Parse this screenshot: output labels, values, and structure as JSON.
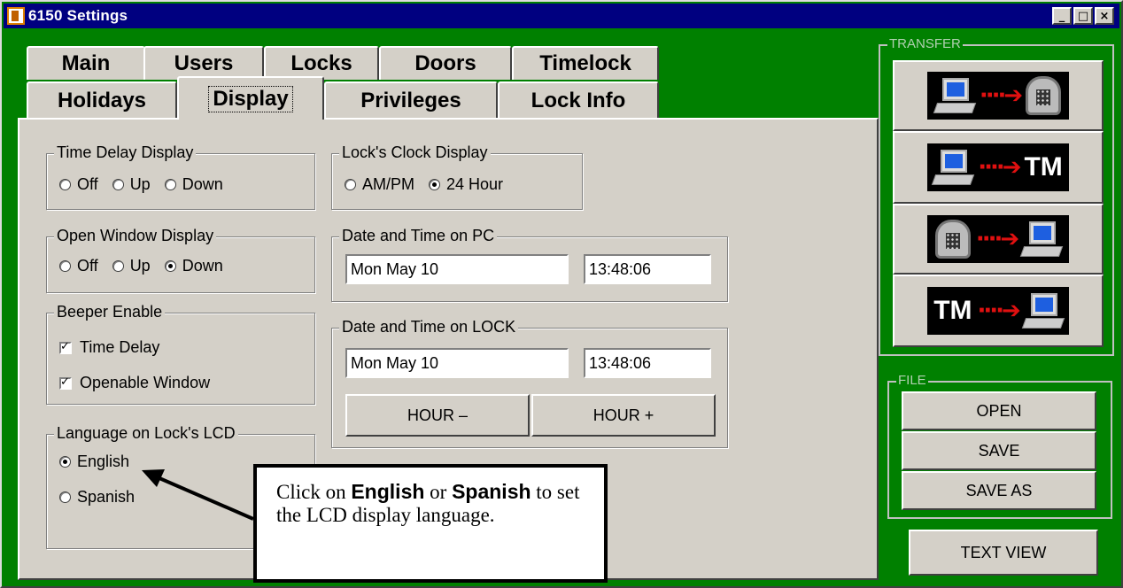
{
  "window": {
    "title": "6150 Settings",
    "controls": {
      "minimize": "_",
      "maximize": "□",
      "close": "×"
    }
  },
  "tabs": {
    "row1": [
      "Main",
      "Users",
      "Locks",
      "Doors",
      "Timelock"
    ],
    "row2": [
      "Holidays",
      "Display",
      "Privileges",
      "Lock Info"
    ],
    "active": "Display"
  },
  "time_delay_display": {
    "legend": "Time Delay Display",
    "options": [
      "Off",
      "Up",
      "Down"
    ],
    "selected": null
  },
  "open_window_display": {
    "legend": "Open Window Display",
    "options": [
      "Off",
      "Up",
      "Down"
    ],
    "selected": "Down"
  },
  "beeper_enable": {
    "legend": "Beeper Enable",
    "time_delay": {
      "label": "Time Delay",
      "checked": true
    },
    "openable_window": {
      "label": "Openable Window",
      "checked": true
    }
  },
  "language": {
    "legend": "Language on Lock's LCD",
    "options": [
      "English",
      "Spanish"
    ],
    "selected": "English"
  },
  "lock_clock_display": {
    "legend": "Lock's Clock Display",
    "options": [
      "AM/PM",
      "24 Hour"
    ],
    "selected": "24 Hour"
  },
  "pc_datetime": {
    "legend": "Date and Time on PC",
    "date": "Mon May 10",
    "time": "13:48:06"
  },
  "lock_datetime": {
    "legend": "Date and Time on LOCK",
    "date": "Mon May 10",
    "time": "13:48:06",
    "hour_minus": "HOUR –",
    "hour_plus": "HOUR +"
  },
  "transfer": {
    "legend": "TRANSFER",
    "buttons": [
      {
        "icon": "pc-to-lock-icon"
      },
      {
        "icon": "pc-to-tm-icon",
        "text": "TM"
      },
      {
        "icon": "lock-to-pc-icon"
      },
      {
        "icon": "tm-to-pc-icon",
        "text": "TM"
      }
    ]
  },
  "file": {
    "legend": "FILE",
    "open": "OPEN",
    "save": "SAVE",
    "save_as": "SAVE AS"
  },
  "text_view": "TEXT VIEW",
  "callout": {
    "prefix": "Click on",
    "english": "English",
    "or": "or",
    "spanish": "Spanish",
    "suffix": "to set the LCD display language."
  },
  "colors": {
    "window_bg": "#008000",
    "title_bar": "#000080",
    "control_face": "#d4d0c8",
    "arrow": "#e01010"
  }
}
